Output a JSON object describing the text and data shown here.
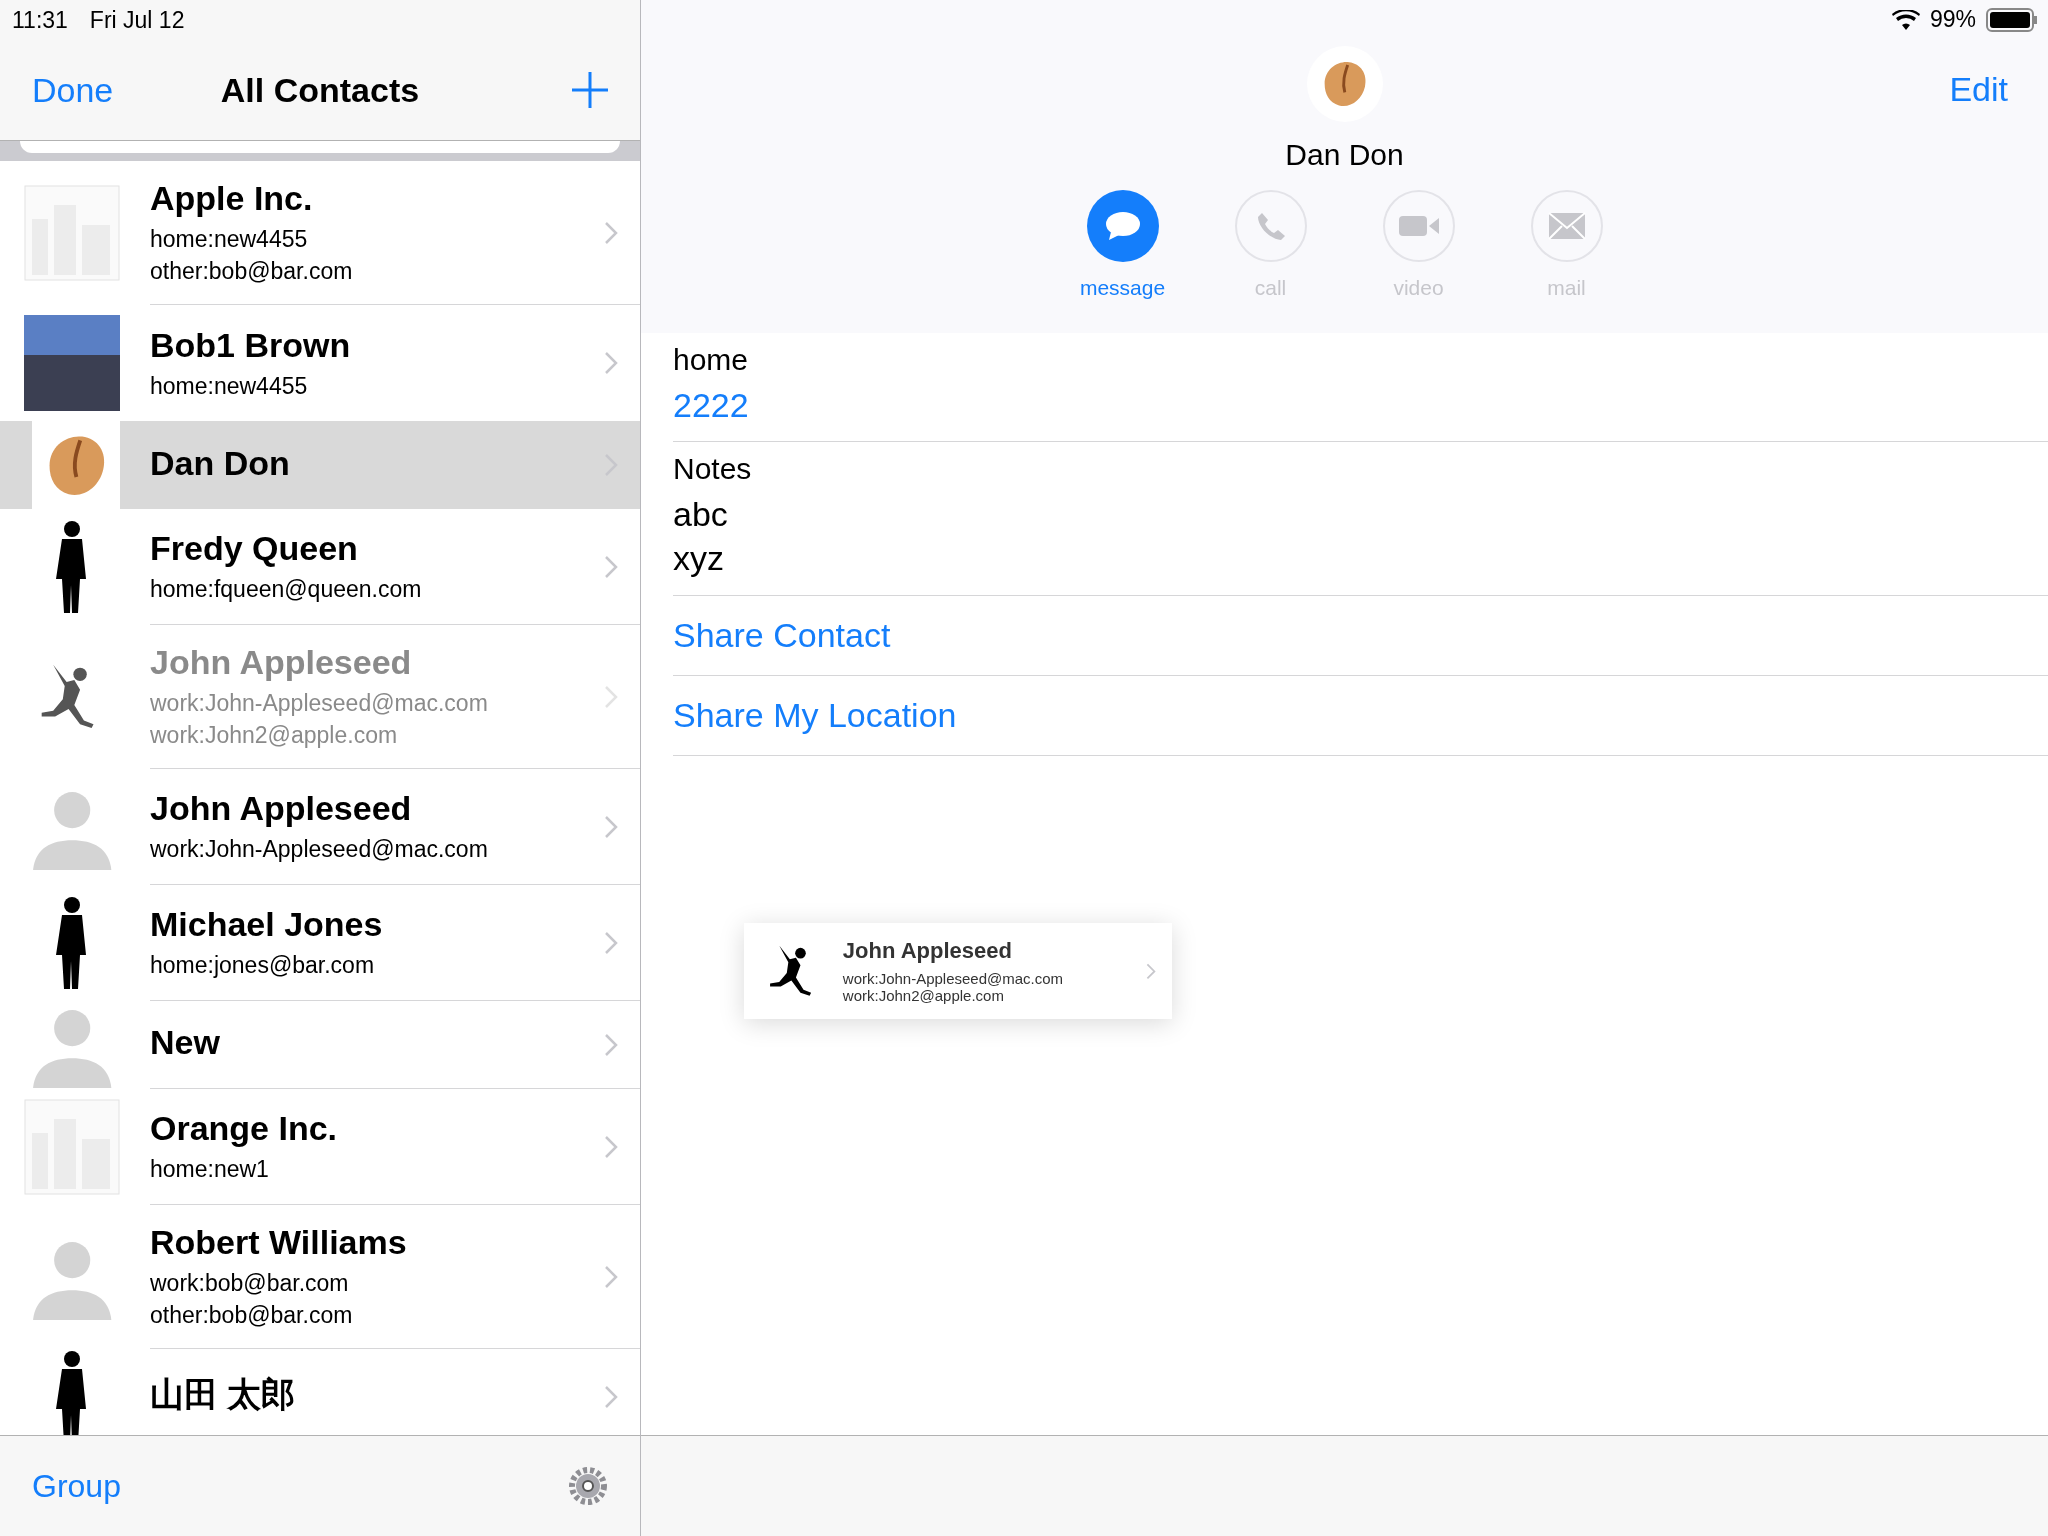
{
  "status_bar": {
    "time": "11:31",
    "date": "Fri Jul 12",
    "battery": "99%"
  },
  "nav": {
    "left": "Done",
    "title": "All Contacts"
  },
  "contacts": [
    {
      "name": "Apple Inc.",
      "details": [
        "home:new4455",
        "other:bob@bar.com"
      ],
      "kind": "building",
      "selected": false,
      "disabled": false
    },
    {
      "name": "Bob1 Brown",
      "details": [
        "home:new4455"
      ],
      "kind": "photo",
      "selected": false,
      "disabled": false
    },
    {
      "name": "Dan Don",
      "kind": "cookie",
      "selected": true,
      "disabled": false
    },
    {
      "name": "Fredy Queen",
      "details": [
        "home:fqueen@queen.com"
      ],
      "kind": "figure",
      "selected": false,
      "disabled": false
    },
    {
      "name": "John Appleseed",
      "details": [
        "work:John-Appleseed@mac.com",
        "work:John2@apple.com"
      ],
      "kind": "jumper",
      "selected": false,
      "disabled": true
    },
    {
      "name": "John Appleseed",
      "details": [
        "work:John-Appleseed@mac.com"
      ],
      "kind": "person",
      "selected": false,
      "disabled": false
    },
    {
      "name": "Michael Jones",
      "details": [
        "home:jones@bar.com"
      ],
      "kind": "figure",
      "selected": false,
      "disabled": false
    },
    {
      "name": "New",
      "kind": "person",
      "selected": false,
      "disabled": false
    },
    {
      "name": "Orange Inc.",
      "details": [
        "home:new1"
      ],
      "kind": "building",
      "selected": false,
      "disabled": false
    },
    {
      "name": "Robert Williams",
      "details": [
        "work:bob@bar.com",
        "other:bob@bar.com"
      ],
      "kind": "person",
      "selected": false,
      "disabled": false
    },
    {
      "name": "山田 太郎",
      "kind": "figure",
      "selected": false,
      "disabled": false
    }
  ],
  "bottom_bar": {
    "left": "Group"
  },
  "detail": {
    "edit": "Edit",
    "name": "Dan Don",
    "actions": [
      {
        "kind": "message",
        "label": "message",
        "enabled": true
      },
      {
        "kind": "call",
        "label": "call",
        "enabled": false
      },
      {
        "kind": "video",
        "label": "video",
        "enabled": false
      },
      {
        "kind": "mail",
        "label": "mail",
        "enabled": false
      }
    ],
    "fields": [
      {
        "label": "home",
        "value": "2222",
        "kind": "link"
      },
      {
        "label": "Notes",
        "value": "abc\nxyz",
        "kind": "text"
      }
    ],
    "links": [
      "Share Contact",
      "Share My Location"
    ]
  },
  "drag_card": {
    "name": "John Appleseed",
    "details": [
      "work:John-Appleseed@mac.com",
      "work:John2@apple.com"
    ]
  }
}
